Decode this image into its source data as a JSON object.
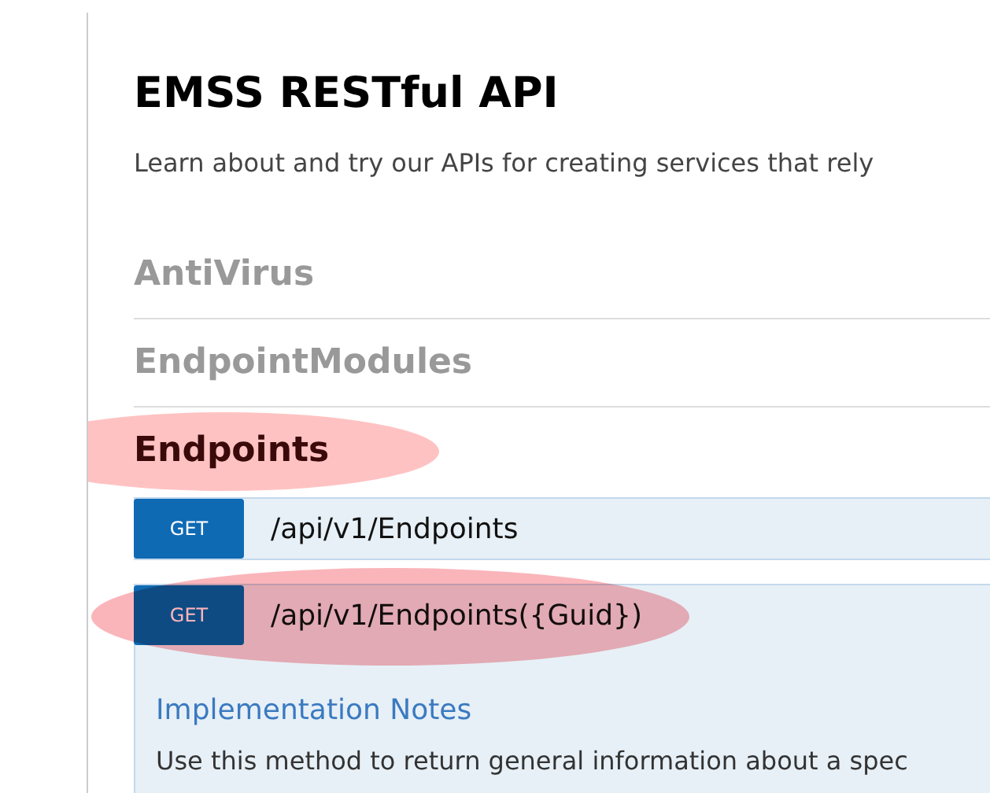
{
  "header": {
    "title": "EMSS RESTful API",
    "description": "Learn about and try our APIs for creating services that rely"
  },
  "sections": [
    {
      "name": "AntiVirus",
      "expanded": false,
      "highlighted": false
    },
    {
      "name": "EndpointModules",
      "expanded": false,
      "highlighted": false
    },
    {
      "name": "Endpoints",
      "expanded": true,
      "highlighted": true,
      "operations": [
        {
          "method": "GET",
          "path": "/api/v1/Endpoints",
          "expanded": false,
          "highlighted": false
        },
        {
          "method": "GET",
          "path": "/api/v1/Endpoints({Guid})",
          "expanded": true,
          "highlighted": true,
          "notes_title": "Implementation Notes",
          "notes": "Use this method to return general information about a spec"
        }
      ]
    }
  ]
}
